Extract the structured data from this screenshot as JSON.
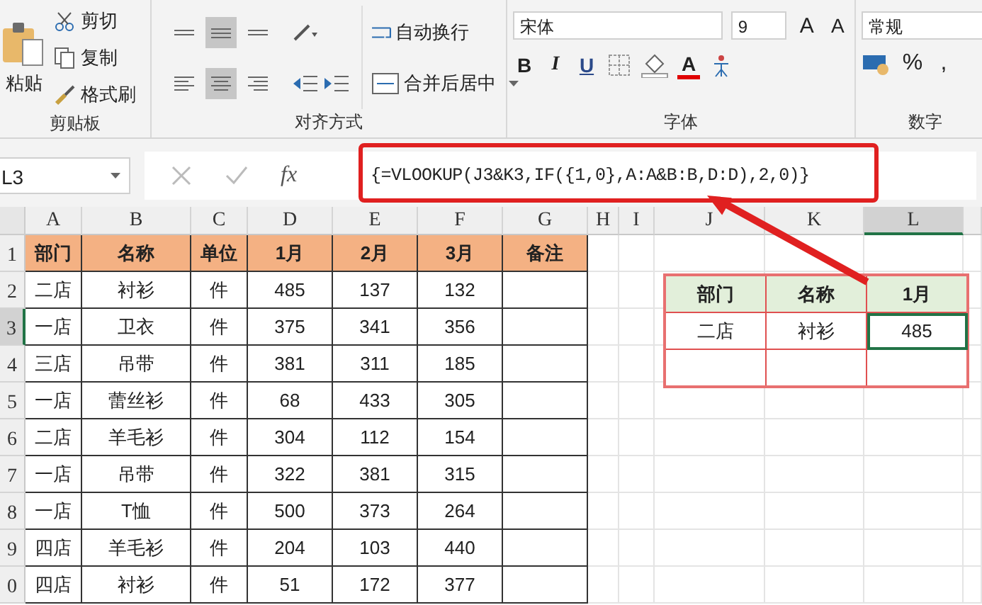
{
  "ribbon": {
    "clipboard": {
      "paste": "粘贴",
      "cut": "剪切",
      "copy": "复制",
      "painter": "格式刷",
      "label": "剪贴板"
    },
    "alignment": {
      "vertical": [
        {
          "kind": "top",
          "selected": false
        },
        {
          "kind": "middle",
          "selected": true
        },
        {
          "kind": "bottom",
          "selected": false
        }
      ],
      "horizontal": [
        {
          "kind": "left",
          "selected": false
        },
        {
          "kind": "center",
          "selected": true
        },
        {
          "kind": "right",
          "selected": false
        }
      ],
      "wrap": "自动换行",
      "merge": "合并后居中",
      "label": "对齐方式"
    },
    "font": {
      "name": "宋体",
      "size": "9",
      "bold": "B",
      "italic": "I",
      "underline": "U",
      "color_letter": "A",
      "grow": "A",
      "shrink": "A",
      "label": "字体"
    },
    "number": {
      "format": "常规",
      "percent": "%",
      "comma": ",",
      "label": "数字"
    }
  },
  "formula_bar": {
    "name_box": "L3",
    "fx": "fx",
    "formula": "{=VLOOKUP(J3&K3,IF({1,0},A:A&B:B,D:D),2,0)}"
  },
  "columns": [
    {
      "label": "A",
      "selected": false
    },
    {
      "label": "B",
      "selected": false
    },
    {
      "label": "C",
      "selected": false
    },
    {
      "label": "D",
      "selected": false
    },
    {
      "label": "E",
      "selected": false
    },
    {
      "label": "F",
      "selected": false
    },
    {
      "label": "G",
      "selected": false
    },
    {
      "label": "H",
      "selected": false
    },
    {
      "label": "I",
      "selected": false
    },
    {
      "label": "J",
      "selected": false
    },
    {
      "label": "K",
      "selected": false
    },
    {
      "label": "L",
      "selected": true
    }
  ],
  "rows": [
    {
      "number": "1",
      "selected": false
    },
    {
      "number": "2",
      "selected": false
    },
    {
      "number": "3",
      "selected": true
    },
    {
      "number": "4",
      "selected": false
    },
    {
      "number": "5",
      "selected": false
    },
    {
      "number": "6",
      "selected": false
    },
    {
      "number": "7",
      "selected": false
    },
    {
      "number": "8",
      "selected": false
    },
    {
      "number": "9",
      "selected": false
    },
    {
      "number": "0",
      "selected": false
    }
  ],
  "table": {
    "headers": [
      "部门",
      "名称",
      "单位",
      "1月",
      "2月",
      "3月",
      "备注"
    ],
    "rows": [
      [
        "二店",
        "衬衫",
        "件",
        "485",
        "137",
        "132"
      ],
      [
        "一店",
        "卫衣",
        "件",
        "375",
        "341",
        "356"
      ],
      [
        "三店",
        "吊带",
        "件",
        "381",
        "311",
        "185"
      ],
      [
        "一店",
        "蕾丝衫",
        "件",
        "68",
        "433",
        "305"
      ],
      [
        "二店",
        "羊毛衫",
        "件",
        "304",
        "112",
        "154"
      ],
      [
        "一店",
        "吊带",
        "件",
        "322",
        "381",
        "315"
      ],
      [
        "一店",
        "T恤",
        "件",
        "500",
        "373",
        "264"
      ],
      [
        "四店",
        "羊毛衫",
        "件",
        "204",
        "103",
        "440"
      ],
      [
        "四店",
        "衬衫",
        "件",
        "51",
        "172",
        "377"
      ]
    ]
  },
  "lookup": {
    "headers": [
      "部门",
      "名称",
      "1月"
    ],
    "rows": [
      [
        {
          "text": "二店",
          "selected": false
        },
        {
          "text": "衬衫",
          "selected": false
        },
        {
          "text": "485",
          "selected": true
        }
      ],
      [
        {
          "text": "",
          "selected": false
        },
        {
          "text": "",
          "selected": false
        },
        {
          "text": "",
          "selected": false
        }
      ]
    ]
  }
}
